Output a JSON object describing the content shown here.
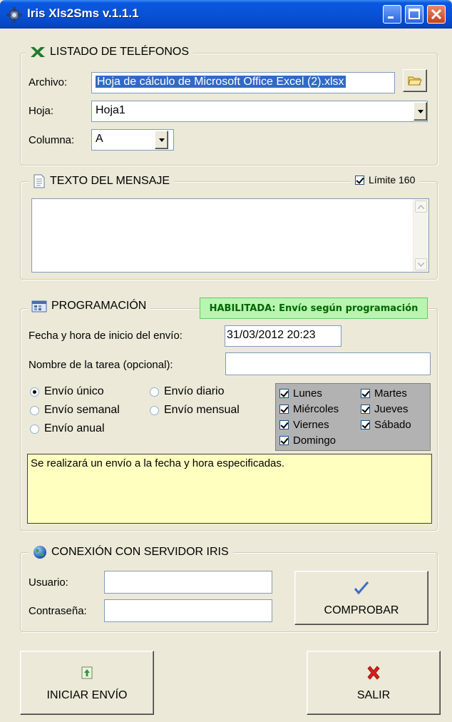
{
  "window": {
    "title": "Iris Xls2Sms v.1.1.1"
  },
  "phones_group": {
    "legend": "LISTADO DE TELÉFONOS",
    "icon": "excel-icon",
    "file_label": "Archivo:",
    "file_value": "Hoja de cálculo de Microsoft Office Excel (2).xlsx",
    "sheet_label": "Hoja:",
    "sheet_value": "Hoja1",
    "column_label": "Columna:",
    "column_value": "A"
  },
  "message_group": {
    "legend": "TEXTO DEL MENSAJE",
    "icon": "document-icon",
    "limit_label": "Límite 160",
    "limit_checked": true,
    "message_text": ""
  },
  "schedule_group": {
    "legend": "PROGRAMACIÓN",
    "icon": "calendar-icon",
    "status_badge": "HABILITADA: Envío según programación",
    "start_label": "Fecha y hora de inicio del envío:",
    "start_value": "31/03/2012 20:23",
    "task_label": "Nombre de la tarea (opcional):",
    "task_value": "",
    "options": {
      "unique": "Envío único",
      "daily": "Envío diario",
      "weekly": "Envío semanal",
      "monthly": "Envío mensual",
      "yearly": "Envío anual"
    },
    "selected_option": "unique",
    "days": {
      "mon": "Lunes",
      "tue": "Martes",
      "wed": "Miércoles",
      "thu": "Jueves",
      "fri": "Viernes",
      "sat": "Sábado",
      "sun": "Domingo"
    },
    "info_text": "Se realizará un envío a la fecha y hora especificadas."
  },
  "connection_group": {
    "legend": "CONEXIÓN CON SERVIDOR IRIS",
    "icon": "globe-icon",
    "user_label": "Usuario:",
    "user_value": "",
    "password_label": "Contraseña:",
    "password_value": "",
    "check_button": "COMPROBAR"
  },
  "actions": {
    "start_button": "INICIAR ENVÍO",
    "exit_button": "SALIR"
  },
  "colors": {
    "title_bar": "#0852d6",
    "badge_bg": "#b8f5b0",
    "info_bg": "#ffffc0",
    "selection": "#316ac5"
  }
}
